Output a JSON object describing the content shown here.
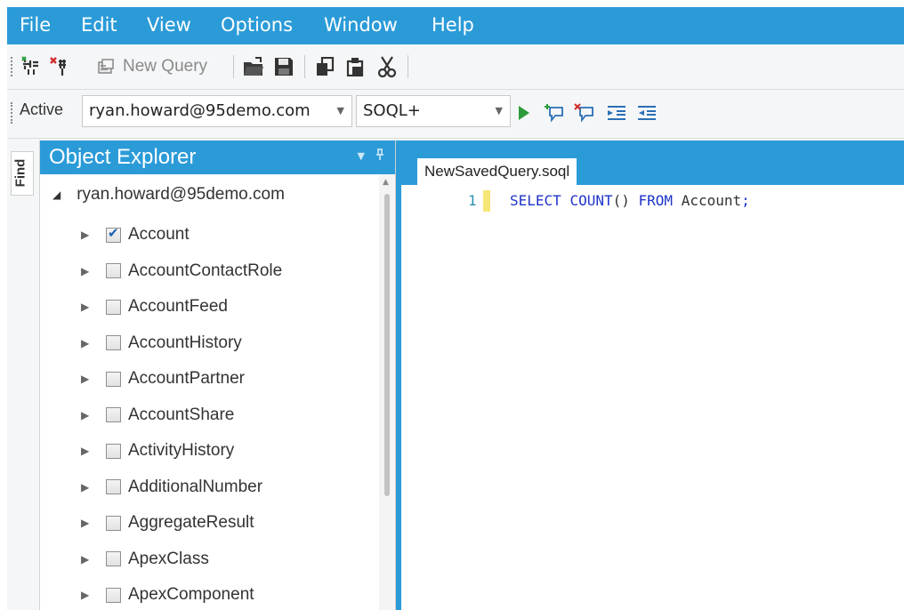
{
  "menu": [
    "File",
    "Edit",
    "View",
    "Options",
    "Window",
    "Help"
  ],
  "toolbar": {
    "new_query_label": "New Query",
    "icons": [
      "connect-icon",
      "disconnect-icon",
      "new-query-icon",
      "open-icon",
      "save-icon",
      "copy-icon",
      "paste-icon",
      "cut-icon"
    ]
  },
  "connection_bar": {
    "active_label": "Active",
    "connection": "ryan.howard@95demo.com",
    "language": "SOQL+",
    "icons": [
      "run-icon",
      "add-comment-icon",
      "remove-comment-icon",
      "indent-icon",
      "outdent-icon"
    ]
  },
  "find_tab": "Find",
  "object_explorer": {
    "title": "Object Explorer",
    "root": "ryan.howard@95demo.com",
    "items": [
      {
        "label": "Account",
        "checked": true
      },
      {
        "label": "AccountContactRole",
        "checked": false
      },
      {
        "label": "AccountFeed",
        "checked": false
      },
      {
        "label": "AccountHistory",
        "checked": false
      },
      {
        "label": "AccountPartner",
        "checked": false
      },
      {
        "label": "AccountShare",
        "checked": false
      },
      {
        "label": "ActivityHistory",
        "checked": false
      },
      {
        "label": "AdditionalNumber",
        "checked": false
      },
      {
        "label": "AggregateResult",
        "checked": false
      },
      {
        "label": "ApexClass",
        "checked": false
      },
      {
        "label": "ApexComponent",
        "checked": false
      }
    ]
  },
  "editor": {
    "tab_title": "NewSavedQuery.soql",
    "line_number": "1",
    "tokens": {
      "select": "SELECT",
      "count": "COUNT",
      "parens": "()",
      "from": "FROM",
      "table": "Account",
      "semicolon": ";"
    }
  },
  "colors": {
    "accent": "#2b9bd8",
    "keyword": "#1f35c8",
    "line_number": "#2b91af",
    "line_marker": "#f6e675"
  }
}
